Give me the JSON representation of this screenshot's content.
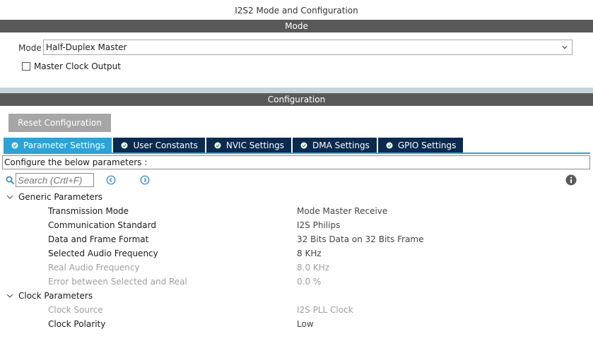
{
  "window": {
    "title": "I2S2 Mode and Configuration"
  },
  "mode_section": {
    "header": "Mode",
    "mode_label": "Mode",
    "mode_value": "Half-Duplex Master",
    "master_clock_output": {
      "label": "Master Clock Output",
      "checked": false
    }
  },
  "config_section": {
    "header": "Configuration",
    "reset_label": "Reset Configuration",
    "tabs": [
      {
        "label": "Parameter Settings",
        "active": true
      },
      {
        "label": "User Constants",
        "active": false
      },
      {
        "label": "NVIC Settings",
        "active": false
      },
      {
        "label": "DMA Settings",
        "active": false
      },
      {
        "label": "GPIO Settings",
        "active": false
      }
    ],
    "configure_text": "Configure the below parameters :",
    "search": {
      "placeholder": "Search (Crtl+F)"
    },
    "groups": [
      {
        "name": "Generic Parameters",
        "params": [
          {
            "name": "Transmission Mode",
            "value": "Mode Master Receive",
            "enabled": true
          },
          {
            "name": "Communication Standard",
            "value": "I2S Philips",
            "enabled": true
          },
          {
            "name": "Data and Frame Format",
            "value": "32 Bits Data on 32 Bits Frame",
            "enabled": true
          },
          {
            "name": "Selected Audio Frequency",
            "value": "8 KHz",
            "enabled": true
          },
          {
            "name": "Real Audio Frequency",
            "value": "8.0 KHz",
            "enabled": false
          },
          {
            "name": "Error between Selected and Real",
            "value": "0.0 %",
            "enabled": false
          }
        ]
      },
      {
        "name": "Clock Parameters",
        "params": [
          {
            "name": "Clock Source",
            "value": "I2S PLL Clock",
            "enabled": false
          },
          {
            "name": "Clock Polarity",
            "value": "Low",
            "enabled": true
          }
        ]
      }
    ]
  },
  "colors": {
    "header_bg": "#595959",
    "tab_active": "#2aa3d8",
    "tab_inactive": "#0b2a4e",
    "check_green": "#2eaa4a",
    "disabled_text": "#9e9e9e"
  },
  "icons": [
    "chevron-down-icon",
    "search-icon",
    "arrow-left-circle-icon",
    "arrow-right-circle-icon",
    "info-icon",
    "check-circle-icon",
    "caret-down-icon"
  ]
}
